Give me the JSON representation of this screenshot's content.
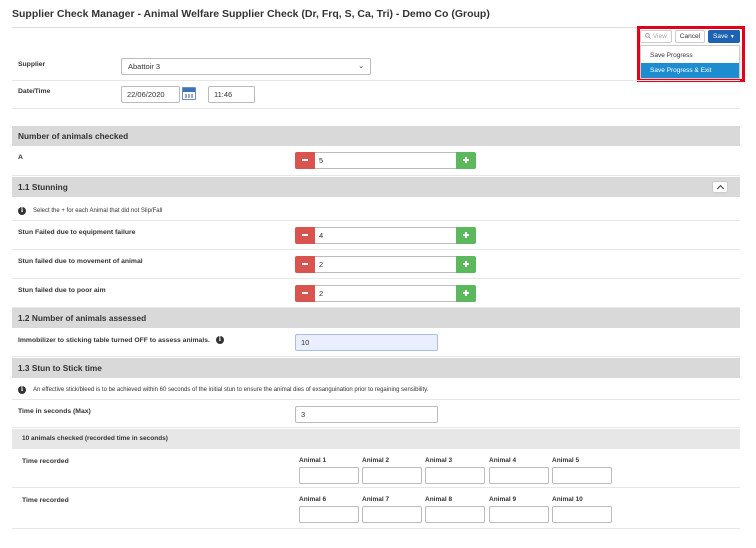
{
  "page_title": "Supplier Check Manager - Animal Welfare Supplier Check (Dr, Frq, S, Ca, Tri) - Demo Co (Group)",
  "toolbar": {
    "view_label": "View",
    "cancel_label": "Cancel",
    "save_label": "Save"
  },
  "save_menu": [
    {
      "label": "Save Progress",
      "active": false
    },
    {
      "label": "Save Progress & Exit",
      "active": true
    }
  ],
  "supplier": {
    "label": "Supplier",
    "value": "Abattoir 3"
  },
  "datetime": {
    "label": "Date/Time",
    "date": "22/06/2020",
    "time": "11:46"
  },
  "sections": {
    "animals_checked": {
      "title": "Number of animals checked",
      "field_label": "A",
      "value": "5"
    },
    "stunning": {
      "title": "1.1 Stunning",
      "info": "Select the + for each Animal that did not Slip/Fall",
      "rows": [
        {
          "label": "Stun Failed due to equipment failure",
          "value": "4"
        },
        {
          "label": "Stun failed due to movement of animal",
          "value": "2"
        },
        {
          "label": "Stun failed due to poor aim",
          "value": "2"
        }
      ]
    },
    "assessed": {
      "title": "1.2 Number of animals assessed",
      "field_label": "Immobilizer to sticking table turned OFF to assess animals.",
      "value": "10"
    },
    "stun_to_stick": {
      "title": "1.3 Stun to Stick time",
      "info": "An effective stick/bleed is to be achieved within 60 seconds of the initial stun to ensure the animal dies of exsanguination prior to regaining sensibility.",
      "time_label": "Time in seconds (Max)",
      "time_value": "3",
      "subsection_title": "10 animals checked (recorded time in seconds)",
      "time_recorded_label": "Time recorded",
      "animals_row1": [
        "Animal 1",
        "Animal 2",
        "Animal 3",
        "Animal 4",
        "Animal 5"
      ],
      "animals_row2": [
        "Animal 6",
        "Animal 7",
        "Animal 8",
        "Animal 9",
        "Animal 10"
      ]
    }
  },
  "colors": {
    "minus": "#d9534f",
    "plus": "#5cb85c",
    "save_button": "#1d62b3",
    "menu_active": "#1e8dcf",
    "highlight": "#e3001b"
  }
}
